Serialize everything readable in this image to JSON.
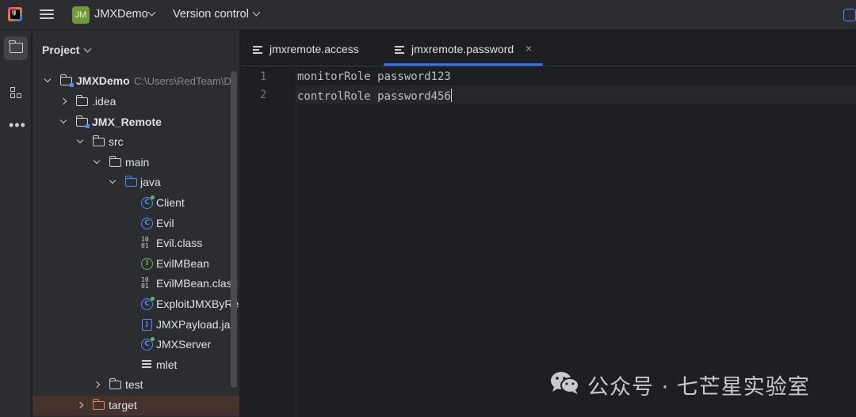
{
  "titlebar": {
    "project_badge": "JM",
    "project_name": "JMXDemo",
    "vcs_label": "Version control"
  },
  "project_panel": {
    "title": "Project",
    "tree": [
      {
        "label": "JMXDemo",
        "path": "C:\\Users\\RedTeam\\De",
        "type": "module-folder",
        "expanded": true,
        "bold": true
      },
      {
        "label": ".idea",
        "type": "folder",
        "expanded": false
      },
      {
        "label": "JMX_Remote",
        "type": "module-folder",
        "expanded": true,
        "bold": true
      },
      {
        "label": "src",
        "type": "folder",
        "expanded": true
      },
      {
        "label": "main",
        "type": "folder",
        "expanded": true
      },
      {
        "label": "java",
        "type": "source-folder",
        "expanded": true
      },
      {
        "label": "Client",
        "type": "class-runnable"
      },
      {
        "label": "Evil",
        "type": "class"
      },
      {
        "label": "Evil.class",
        "type": "binary"
      },
      {
        "label": "EvilMBean",
        "type": "interface"
      },
      {
        "label": "EvilMBean.class",
        "type": "binary"
      },
      {
        "label": "ExploitJMXByRer",
        "type": "class-runnable"
      },
      {
        "label": "JMXPayload.jar",
        "type": "jar"
      },
      {
        "label": "JMXServer",
        "type": "class-runnable"
      },
      {
        "label": "mlet",
        "type": "text"
      },
      {
        "label": "test",
        "type": "folder",
        "expanded": false
      },
      {
        "label": "target",
        "type": "excluded-folder",
        "expanded": false
      }
    ]
  },
  "editor": {
    "tabs": [
      {
        "label": "jmxremote.access",
        "active": false
      },
      {
        "label": "jmxremote.password",
        "active": true,
        "close": "×"
      }
    ],
    "lines": [
      {
        "number": "1",
        "text": "monitorRole password123"
      },
      {
        "number": "2",
        "text": "controlRole password456"
      }
    ]
  },
  "watermark": {
    "text": "公众号 · 七芒星实验室",
    "icon": "wechat-icon"
  },
  "colors": {
    "accent": "#3574f0",
    "panel_bg": "#2b2d30",
    "editor_bg": "#1e1f22",
    "excluded_highlight": "#45322b",
    "project_badge": "#6f9a3a"
  }
}
